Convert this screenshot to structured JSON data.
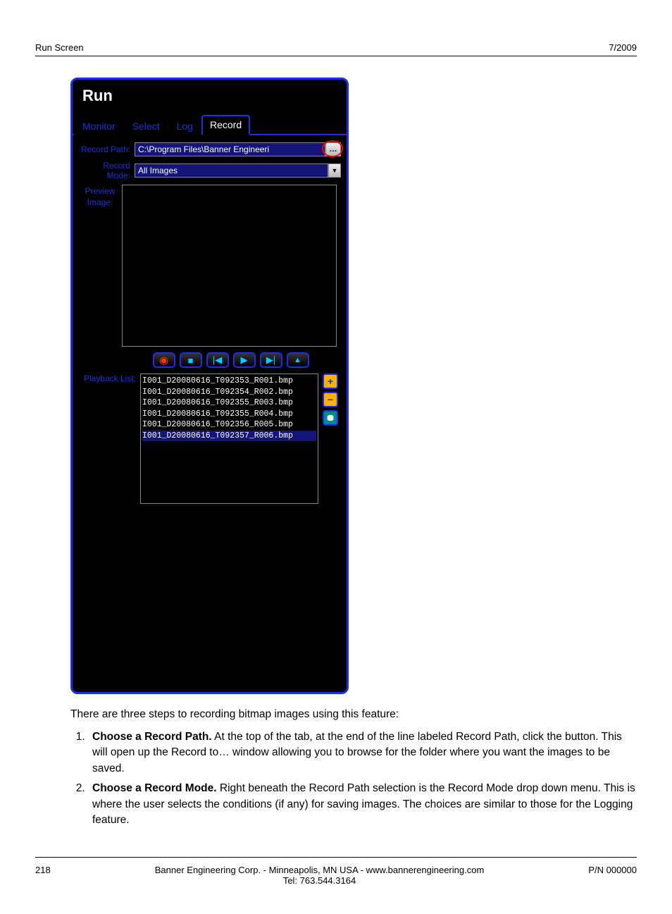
{
  "header": {
    "left": "Run Screen",
    "right": "7/2009"
  },
  "panel": {
    "title": "Run",
    "tabs": [
      "Monitor",
      "Select",
      "Log",
      "Record"
    ],
    "active_tab_index": 3,
    "record_path_label": "Record Path:",
    "record_path_value": "C:\\Program Files\\Banner Engineeri",
    "record_mode_label": "Record Mode:",
    "record_mode_value": "All Images",
    "preview_label_line1": "Preview",
    "preview_label_line2": "Image:",
    "playback_label": "Playback List:",
    "playback_items": [
      "I001_D20080616_T092353_R001.bmp",
      "I001_D20080616_T092354_R002.bmp",
      "I001_D20080616_T092355_R003.bmp",
      "I001_D20080616_T092355_R004.bmp",
      "I001_D20080616_T092356_R005.bmp",
      "I001_D20080616_T092357_R006.bmp"
    ],
    "playback_selected_index": 5
  },
  "doc": {
    "intro": "There are three steps to recording bitmap images using this feature:",
    "step1_bold": "Choose a Record Path.",
    "step1_text": " At the top of the tab, at the end of the line labeled Record Path, click the button. This will open up the Record to… window allowing you to browse for the folder where you want the images to be saved.",
    "step2_bold": "Choose a Record Mode.",
    "step2_text": " Right beneath the Record Path selection is the Record Mode drop down menu. This is where the user selects the conditions (if any) for saving images. The choices are similar to those for the Logging feature."
  },
  "footer": {
    "page": "218",
    "center_line1": "Banner Engineering Corp. - Minneapolis, MN USA - www.bannerengineering.com",
    "center_line2": "Tel: 763.544.3164",
    "right": "P/N 000000"
  }
}
